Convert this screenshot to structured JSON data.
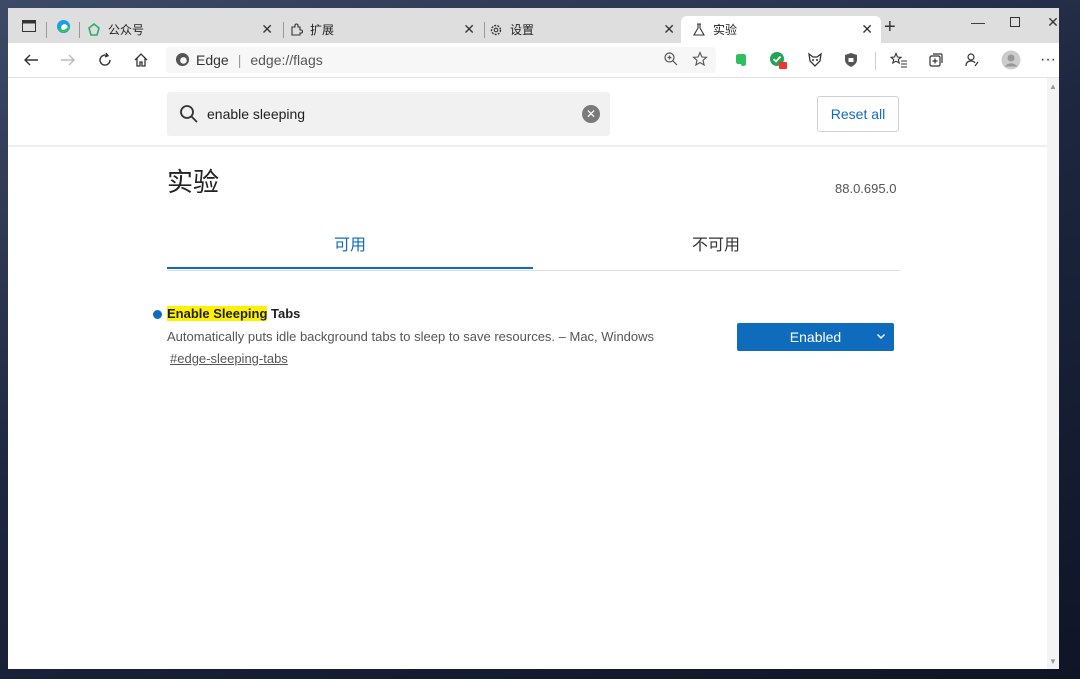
{
  "tabs": [
    {
      "label": "公众号",
      "icon": "wechat-icon"
    },
    {
      "label": "扩展",
      "icon": "puzzle-icon"
    },
    {
      "label": "设置",
      "icon": "gear-icon"
    },
    {
      "label": "实验",
      "icon": "flask-icon",
      "active": true
    }
  ],
  "toolbar": {
    "site_name": "Edge",
    "url": "edge://flags"
  },
  "search": {
    "value": "enable sleeping"
  },
  "reset_label": "Reset all",
  "page": {
    "title": "实验",
    "version": "88.0.695.0",
    "tab_available": "可用",
    "tab_unavailable": "不可用"
  },
  "experiment": {
    "title_highlight": "Enable Sleeping",
    "title_rest": " Tabs",
    "description": "Automatically puts idle background tabs to sleep to save resources. – Mac, Windows",
    "link": "#edge-sleeping-tabs",
    "state": "Enabled"
  },
  "colors": {
    "accent": "#0f6cbd",
    "highlight": "#fff200",
    "tabstrip": "#dedede"
  }
}
